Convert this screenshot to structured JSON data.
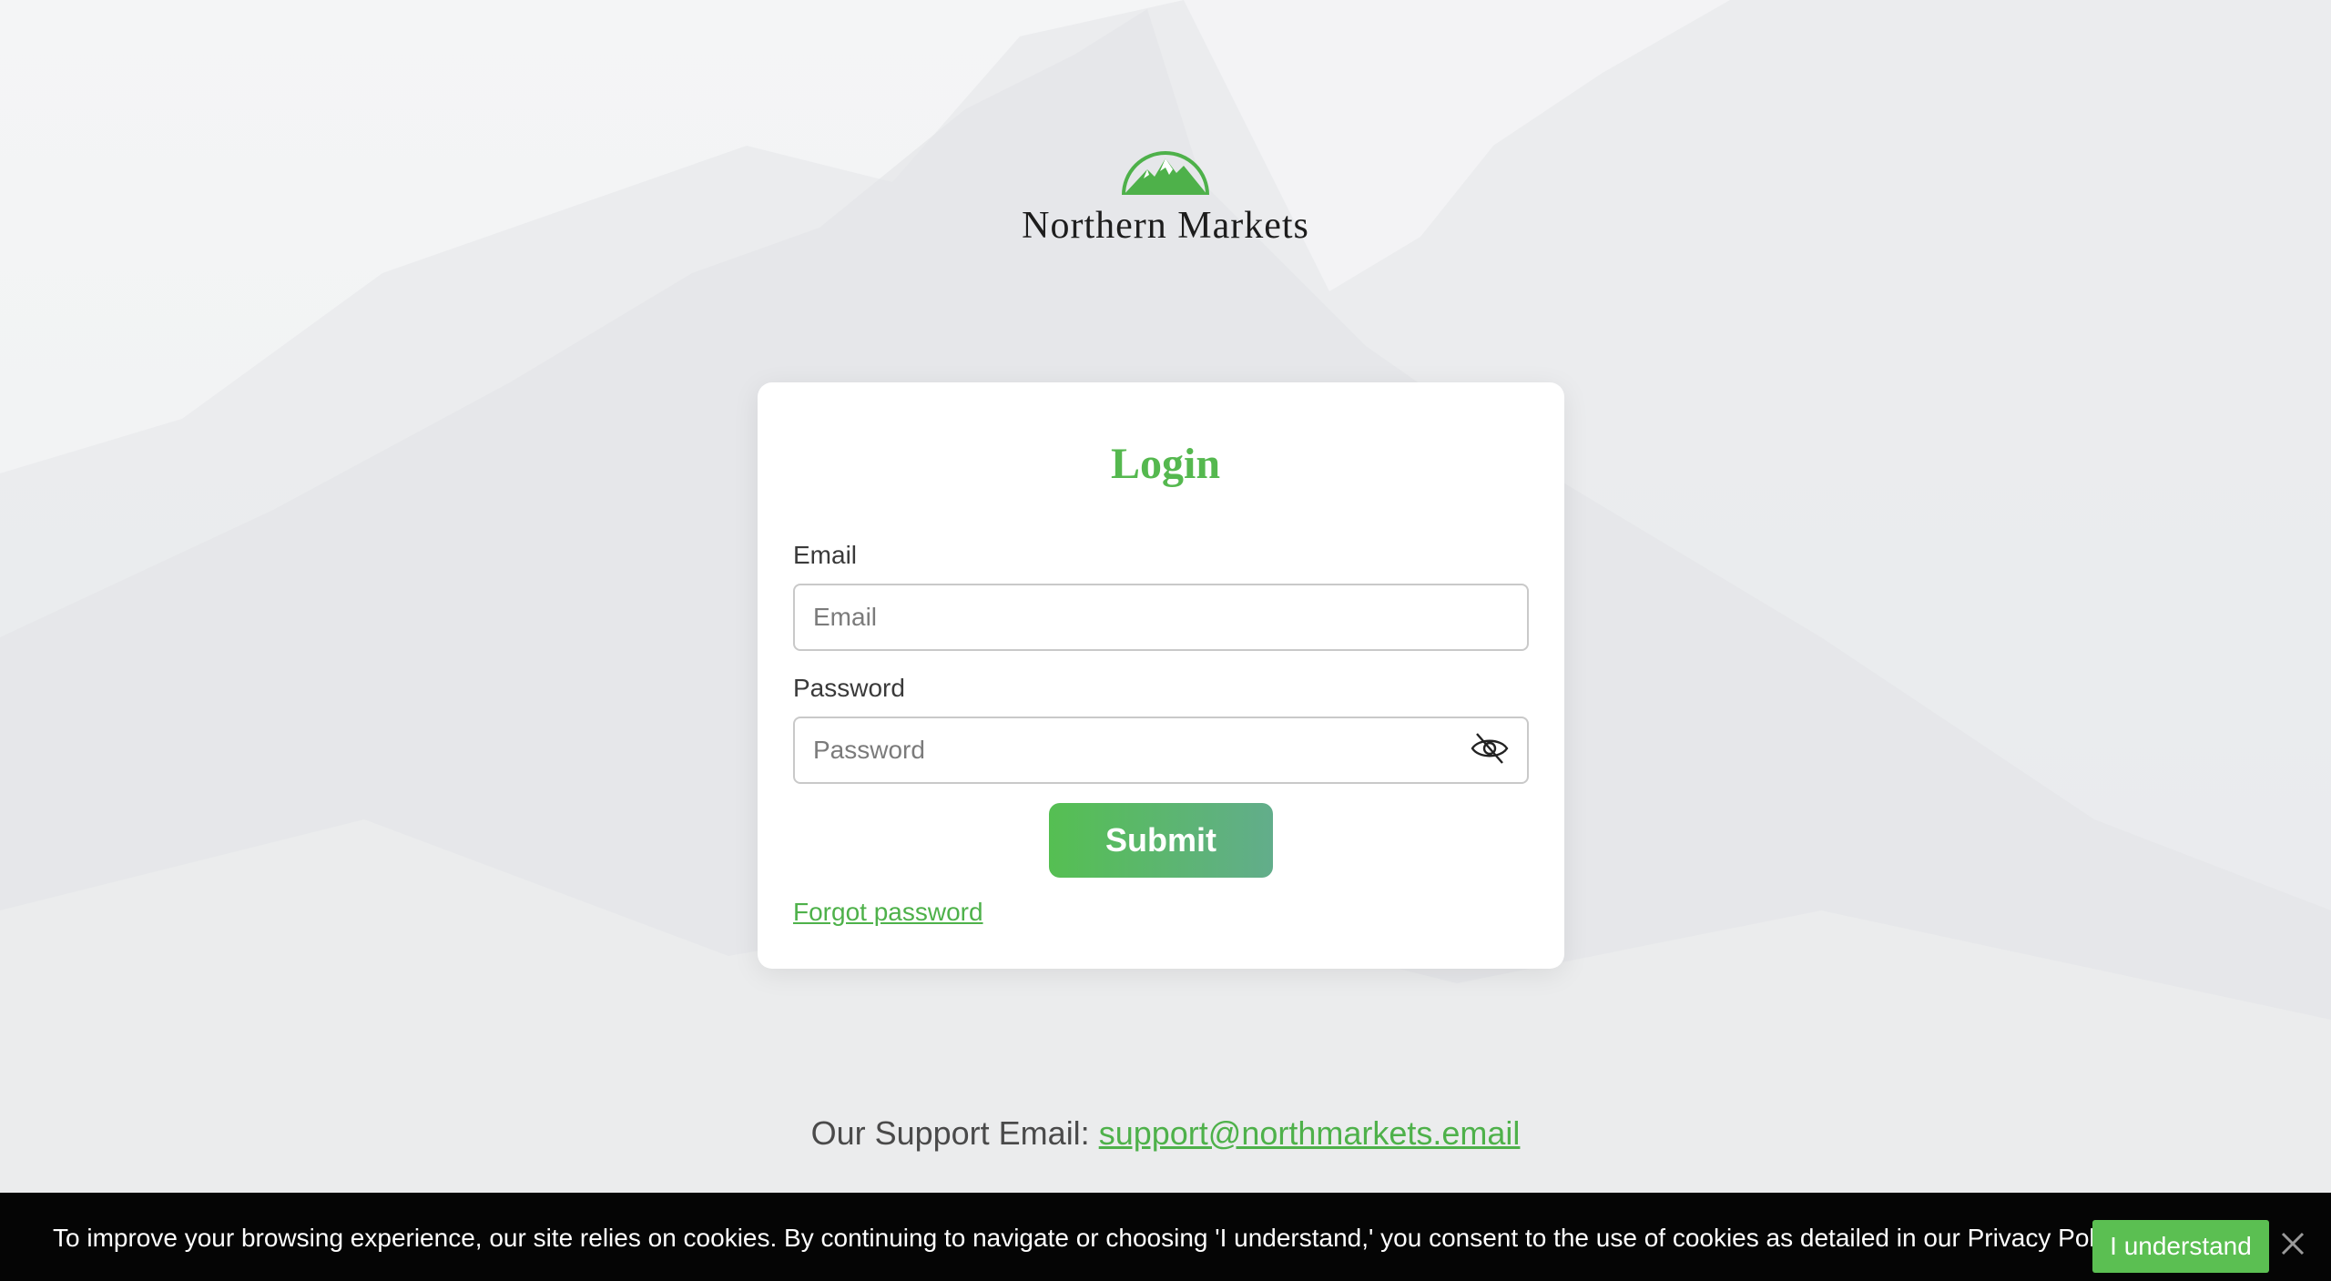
{
  "brand": {
    "name": "Northern Markets",
    "logo_icon": "mountain-logo-icon",
    "color": "#55b84f"
  },
  "login": {
    "title": "Login",
    "email": {
      "label": "Email",
      "placeholder": "Email",
      "value": ""
    },
    "password": {
      "label": "Password",
      "placeholder": "Password",
      "value": "",
      "toggle_icon": "eye-slash-icon"
    },
    "submit_label": "Submit",
    "forgot_label": "Forgot password"
  },
  "support": {
    "prefix": "Our Support Email:",
    "email": "support@northmarkets.email"
  },
  "cookie_banner": {
    "text": "To improve your browsing experience, our site relies on cookies. By continuing to navigate or choosing 'I understand,' you consent to the use of cookies as detailed in our Privacy Policy.",
    "accept_label": "I understand",
    "close_icon": "close-icon"
  }
}
